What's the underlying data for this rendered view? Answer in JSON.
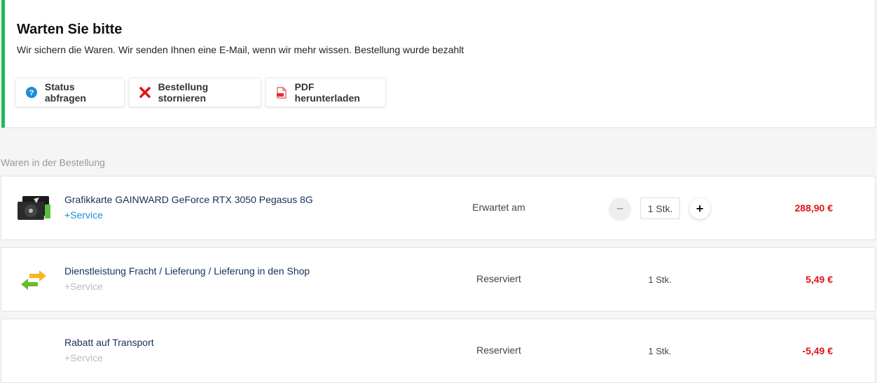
{
  "status": {
    "title": "Warten Sie bitte",
    "message": "Wir sichern die Waren. Wir senden Ihnen eine E-Mail, wenn wir mehr wissen. Bestellung wurde bezahlt",
    "accent_color": "#1fba5a",
    "actions": [
      {
        "label": "Status abfragen",
        "icon": "question-circle-icon"
      },
      {
        "label": "Bestellung stornieren",
        "icon": "red-x-icon"
      },
      {
        "label": "PDF herunterladen",
        "icon": "pdf-file-icon"
      }
    ]
  },
  "items_section": {
    "label": "Waren in der Bestellung",
    "items": [
      {
        "name": "Grafikkarte GAINWARD GeForce RTX 3050 Pegasus 8G",
        "service": "+Service",
        "status": "Erwartet am",
        "quantity": "1 Stk.",
        "price": "288,90 €",
        "thumbnail": "graphics-card-image"
      },
      {
        "name": "Dienstleistung Fracht / Lieferung / Lieferung in den Shop",
        "service": "+Service",
        "status": "Reserviert",
        "quantity": "1 Stk.",
        "price": "5,49 €",
        "thumbnail": "exchange-arrows-icon"
      },
      {
        "name": "Rabatt auf Transport",
        "service": "+Service",
        "status": "Reserviert",
        "quantity": "1 Stk.",
        "price": "-5,49 €"
      }
    ]
  },
  "colors": {
    "price": "#e01414",
    "link": "#1a8fd6",
    "item_name": "#14305a"
  }
}
